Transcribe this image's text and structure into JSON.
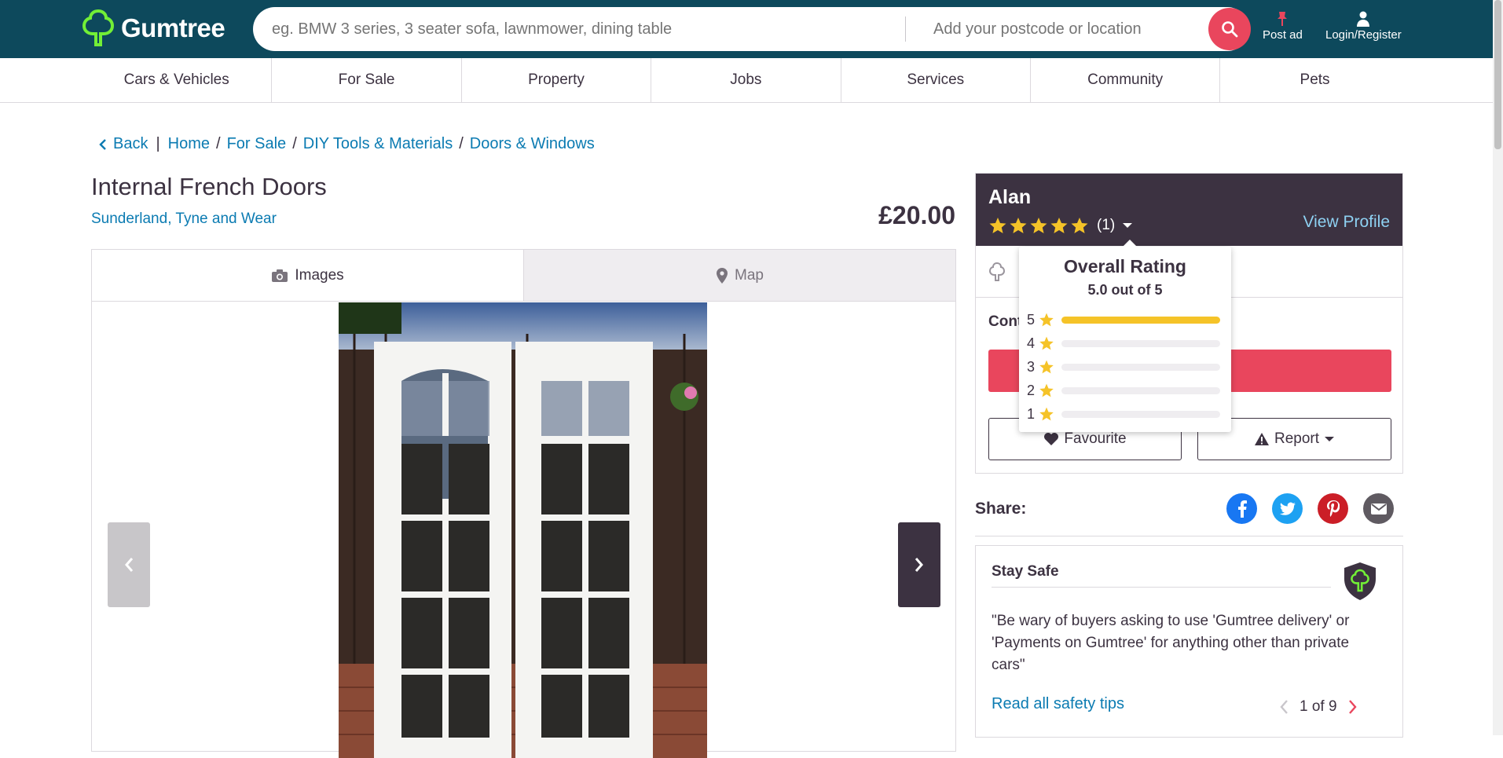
{
  "header": {
    "logo_text": "Gumtree",
    "search_placeholder": "eg. BMW 3 series, 3 seater sofa, lawnmower, dining table",
    "location_placeholder": "Add your postcode or location",
    "post_ad_label": "Post ad",
    "login_label": "Login/Register"
  },
  "nav": {
    "items": [
      "Cars & Vehicles",
      "For Sale",
      "Property",
      "Jobs",
      "Services",
      "Community",
      "Pets"
    ]
  },
  "breadcrumb": {
    "back": "Back",
    "crumbs": [
      "Home",
      "For Sale",
      "DIY Tools & Materials",
      "Doors & Windows"
    ]
  },
  "listing": {
    "title": "Internal French Doors",
    "location": "Sunderland, Tyne and Wear",
    "price": "£20.00"
  },
  "gallery": {
    "tab_images": "Images",
    "tab_map": "Map"
  },
  "seller": {
    "name": "Alan",
    "rating_count": "(1)",
    "view_profile": "View Profile",
    "contact_label": "Cont",
    "favourite_label": "Favourite",
    "report_label": "Report"
  },
  "rating_popover": {
    "title": "Overall Rating",
    "subtitle": "5.0 out of 5",
    "rows": [
      {
        "stars": "5",
        "share": 1.0
      },
      {
        "stars": "4",
        "share": 0
      },
      {
        "stars": "3",
        "share": 0
      },
      {
        "stars": "2",
        "share": 0
      },
      {
        "stars": "1",
        "share": 0
      }
    ]
  },
  "share": {
    "label": "Share:",
    "networks": [
      "facebook",
      "twitter",
      "pinterest",
      "email"
    ]
  },
  "stay_safe": {
    "title": "Stay Safe",
    "quote": "\"Be wary of buyers asking to use 'Gumtree delivery' or 'Payments on Gumtree' for anything other than private cars\"",
    "link": "Read all safety tips",
    "pager": "1 of 9"
  },
  "colors": {
    "header_bg": "#0d495c",
    "brand_green": "#72ef36",
    "accent_red": "#e9465d",
    "link_blue": "#0b7bb2",
    "seller_bg": "#3c3241",
    "star_yellow": "#f5c328"
  }
}
